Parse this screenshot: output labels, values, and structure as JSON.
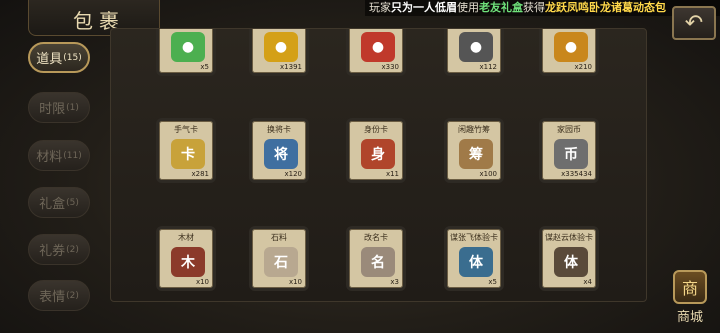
{
  "title": "包裹",
  "marquee": {
    "prefix": "玩家",
    "player": "只为一人低眉",
    "middle": "使用",
    "item": "老友礼盒",
    "verb": "获得",
    "reward": "龙跃凤鸣",
    "tail": "卧龙诸葛动态包"
  },
  "back_icon": "↶",
  "tabs": [
    {
      "label": "道具",
      "count": "(15)",
      "active": true
    },
    {
      "label": "时限",
      "count": "(1)",
      "active": false
    },
    {
      "label": "材料",
      "count": "(11)",
      "active": false
    },
    {
      "label": "礼盒",
      "count": "(5)",
      "active": false
    },
    {
      "label": "礼券",
      "count": "(2)",
      "active": false
    },
    {
      "label": "表情",
      "count": "(2)",
      "active": false
    }
  ],
  "rows": [
    [
      {
        "name": "",
        "qty": "x5",
        "icon": "●",
        "color": "#4caf50"
      },
      {
        "name": "",
        "qty": "x1391",
        "icon": "●",
        "color": "#d4a017"
      },
      {
        "name": "",
        "qty": "x330",
        "icon": "●",
        "color": "#c0392b"
      },
      {
        "name": "",
        "qty": "x112",
        "icon": "●",
        "color": "#555555"
      },
      {
        "name": "",
        "qty": "x210",
        "icon": "●",
        "color": "#c9871c"
      }
    ],
    [
      {
        "name": "手气卡",
        "qty": "x281",
        "icon": "卡",
        "color": "#c8a23a"
      },
      {
        "name": "换将卡",
        "qty": "x120",
        "icon": "将",
        "color": "#3f6fa0"
      },
      {
        "name": "身份卡",
        "qty": "x11",
        "icon": "身",
        "color": "#b0452b"
      },
      {
        "name": "闲趣竹筹",
        "qty": "x100",
        "icon": "筹",
        "color": "#a07a48"
      },
      {
        "name": "家园币",
        "qty": "x335434",
        "icon": "币",
        "color": "#6e6e6e"
      }
    ],
    [
      {
        "name": "木材",
        "qty": "x10",
        "icon": "木",
        "color": "#8b3a2a"
      },
      {
        "name": "石料",
        "qty": "x10",
        "icon": "石",
        "color": "#b8a890"
      },
      {
        "name": "改名卡",
        "qty": "x3",
        "icon": "名",
        "color": "#9a8a7a"
      },
      {
        "name": "谋张飞体验卡",
        "qty": "x5",
        "icon": "体",
        "color": "#3a6d8f"
      },
      {
        "name": "谋赵云体验卡",
        "qty": "x4",
        "icon": "体",
        "color": "#5a4a3a"
      }
    ]
  ],
  "mall": {
    "label": "商城",
    "icon": "商"
  }
}
